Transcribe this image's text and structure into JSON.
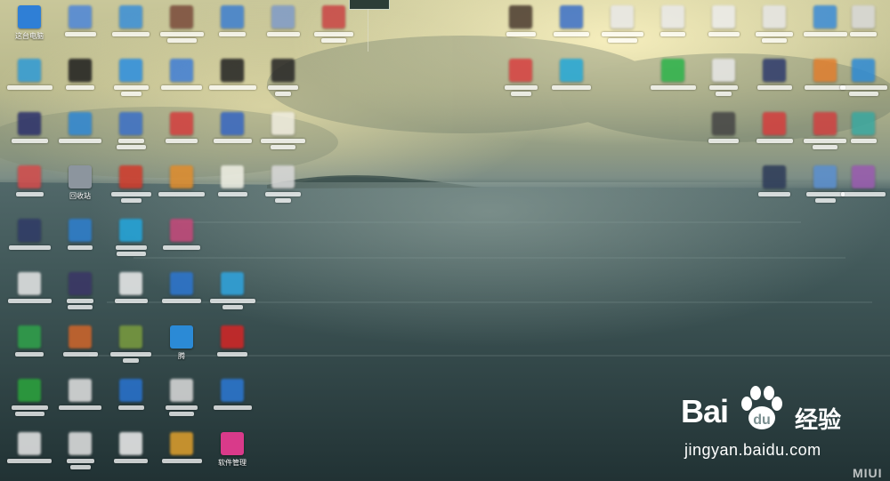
{
  "desktop": {
    "icons": [
      {
        "label": "这台电脑",
        "icon": "computer-icon",
        "color": "#2f7fd6"
      },
      {
        "label": "",
        "icon": "app-icon",
        "color": "#4d86d9"
      },
      {
        "label": "",
        "icon": "app-icon",
        "color": "#3a8fd8"
      },
      {
        "label": "",
        "icon": "app-icon",
        "color": "#7a4a3a"
      },
      {
        "label": "",
        "icon": "app-icon",
        "color": "#3d7fd0"
      },
      {
        "label": "",
        "icon": "app-icon",
        "color": "#7f9bc8"
      },
      {
        "label": "",
        "icon": "app-icon",
        "color": "#c94343"
      },
      {
        "label": "",
        "icon": "app-icon",
        "color": "#2e9ad6"
      },
      {
        "label": "",
        "icon": "app-icon",
        "color": "#1d1d1d"
      },
      {
        "label": "",
        "icon": "app-icon",
        "color": "#2b8ee0"
      },
      {
        "label": "",
        "icon": "app-icon",
        "color": "#3f7ed6"
      },
      {
        "label": "",
        "icon": "app-icon",
        "color": "#222222"
      },
      {
        "label": "",
        "icon": "app-icon",
        "color": "#252525"
      },
      {
        "label": "",
        "icon": "app-icon",
        "color": "#2a2f6a"
      },
      {
        "label": "",
        "icon": "app-icon",
        "color": "#2d86d3"
      },
      {
        "label": "",
        "icon": "app-icon",
        "color": "#3a6fc7"
      },
      {
        "label": "",
        "icon": "app-icon",
        "color": "#d33d3d"
      },
      {
        "label": "",
        "icon": "app-icon",
        "color": "#3565c1"
      },
      {
        "label": "",
        "icon": "app-icon",
        "color": "#f0ede0"
      },
      {
        "label": "",
        "icon": "app-icon",
        "color": "#d44b4b"
      },
      {
        "label": "回收站",
        "icon": "recycle-bin-icon",
        "color": "#8c959e"
      },
      {
        "label": "",
        "icon": "app-icon",
        "color": "#d23a2a"
      },
      {
        "label": "",
        "icon": "app-icon",
        "color": "#e08c2c"
      },
      {
        "label": "",
        "icon": "app-icon",
        "color": "#f1f1e6"
      },
      {
        "label": "",
        "icon": "app-icon",
        "color": "#d9d9d9"
      },
      {
        "label": "",
        "icon": "app-icon",
        "color": "#2f3a66"
      },
      {
        "label": "",
        "icon": "app-icon",
        "color": "#2d7fcf"
      },
      {
        "label": "",
        "icon": "app-icon",
        "color": "#23a6dd"
      },
      {
        "label": "",
        "icon": "app-icon",
        "color": "#c6487a"
      },
      {
        "label": "",
        "icon": "app-icon",
        "color": "#e8e8e8"
      },
      {
        "label": "",
        "icon": "app-icon",
        "color": "#3a3566"
      },
      {
        "label": "",
        "icon": "app-icon",
        "color": "#eeeeee"
      },
      {
        "label": "",
        "icon": "app-icon",
        "color": "#2c76d1"
      },
      {
        "label": "",
        "icon": "app-icon",
        "color": "#2fa5e0"
      },
      {
        "label": "",
        "icon": "app-icon",
        "color": "#2fa24a"
      },
      {
        "label": "",
        "icon": "app-icon",
        "color": "#d0652a"
      },
      {
        "label": "",
        "icon": "app-icon",
        "color": "#7a9c3e"
      },
      {
        "label": "腾",
        "icon": "app-icon",
        "color": "#2b8ad6"
      },
      {
        "label": "",
        "icon": "app-icon",
        "color": "#d42525"
      },
      {
        "label": "",
        "icon": "app-icon",
        "color": "#2ba43c"
      },
      {
        "label": "",
        "icon": "app-icon",
        "color": "#e2e2e2"
      },
      {
        "label": "",
        "icon": "app-icon",
        "color": "#2873d0"
      },
      {
        "label": "",
        "icon": "app-icon",
        "color": "#dcdcdc"
      },
      {
        "label": "",
        "icon": "app-icon",
        "color": "#2b78d4"
      },
      {
        "label": "",
        "icon": "app-icon",
        "color": "#e8e8e8"
      },
      {
        "label": "",
        "icon": "app-icon",
        "color": "#e4e4e4"
      },
      {
        "label": "",
        "icon": "app-icon",
        "color": "#f0f0f0"
      },
      {
        "label": "",
        "icon": "app-icon",
        "color": "#e0a02c"
      },
      {
        "label": "软件管理",
        "icon": "software-manager-icon",
        "color": "#d93a8a"
      },
      {
        "label": "",
        "icon": "app-icon",
        "color": "#4a3a2e"
      },
      {
        "label": "",
        "icon": "app-icon",
        "color": "#3a6fc7"
      },
      {
        "label": "",
        "icon": "app-icon",
        "color": "#e8e8e8"
      },
      {
        "label": "",
        "icon": "app-icon",
        "color": "#e9e9e9"
      },
      {
        "label": "",
        "icon": "app-icon",
        "color": "#ececec"
      },
      {
        "label": "",
        "icon": "app-icon",
        "color": "#e6e6e6"
      },
      {
        "label": "",
        "icon": "app-icon",
        "color": "#3a8bd6"
      },
      {
        "label": "",
        "icon": "app-icon",
        "color": "#d8d8d8"
      },
      {
        "label": "",
        "icon": "app-icon",
        "color": "#d84040"
      },
      {
        "label": "",
        "icon": "app-icon",
        "color": "#23a8d8"
      },
      {
        "label": "",
        "icon": "app-icon",
        "color": "#2bb34a"
      },
      {
        "label": "",
        "icon": "app-icon",
        "color": "#e8e8e8"
      },
      {
        "label": "",
        "icon": "app-icon",
        "color": "#2d3a6c"
      },
      {
        "label": "",
        "icon": "app-icon",
        "color": "#e07e2e"
      },
      {
        "label": "",
        "icon": "app-icon",
        "color": "#2d8ad4"
      },
      {
        "label": "",
        "icon": "app-icon",
        "color": "#444444"
      },
      {
        "label": "",
        "icon": "app-icon",
        "color": "#d43c3c"
      },
      {
        "label": "",
        "icon": "app-icon",
        "color": "#d04040"
      },
      {
        "label": "",
        "icon": "app-icon",
        "color": "#3aa8a0"
      },
      {
        "label": "",
        "icon": "app-icon",
        "color": "#2c3a58"
      },
      {
        "label": "",
        "icon": "app-icon",
        "color": "#5a8fd0"
      },
      {
        "label": "",
        "icon": "app-icon",
        "color": "#9a5ab0"
      },
      {
        "label": "",
        "icon": "app-icon",
        "color": "#2f8ed8"
      },
      {
        "label": "",
        "icon": "app-icon",
        "color": "#3aa66a"
      },
      {
        "label": "",
        "icon": "app-icon",
        "color": "#e89070"
      },
      {
        "label": "",
        "icon": "app-icon",
        "color": "#3a7fd6"
      }
    ]
  },
  "watermark": {
    "brand_left": "Bai",
    "brand_right": "经验",
    "url": "jingyan.baidu.com"
  },
  "corner_mark": "MIUI"
}
